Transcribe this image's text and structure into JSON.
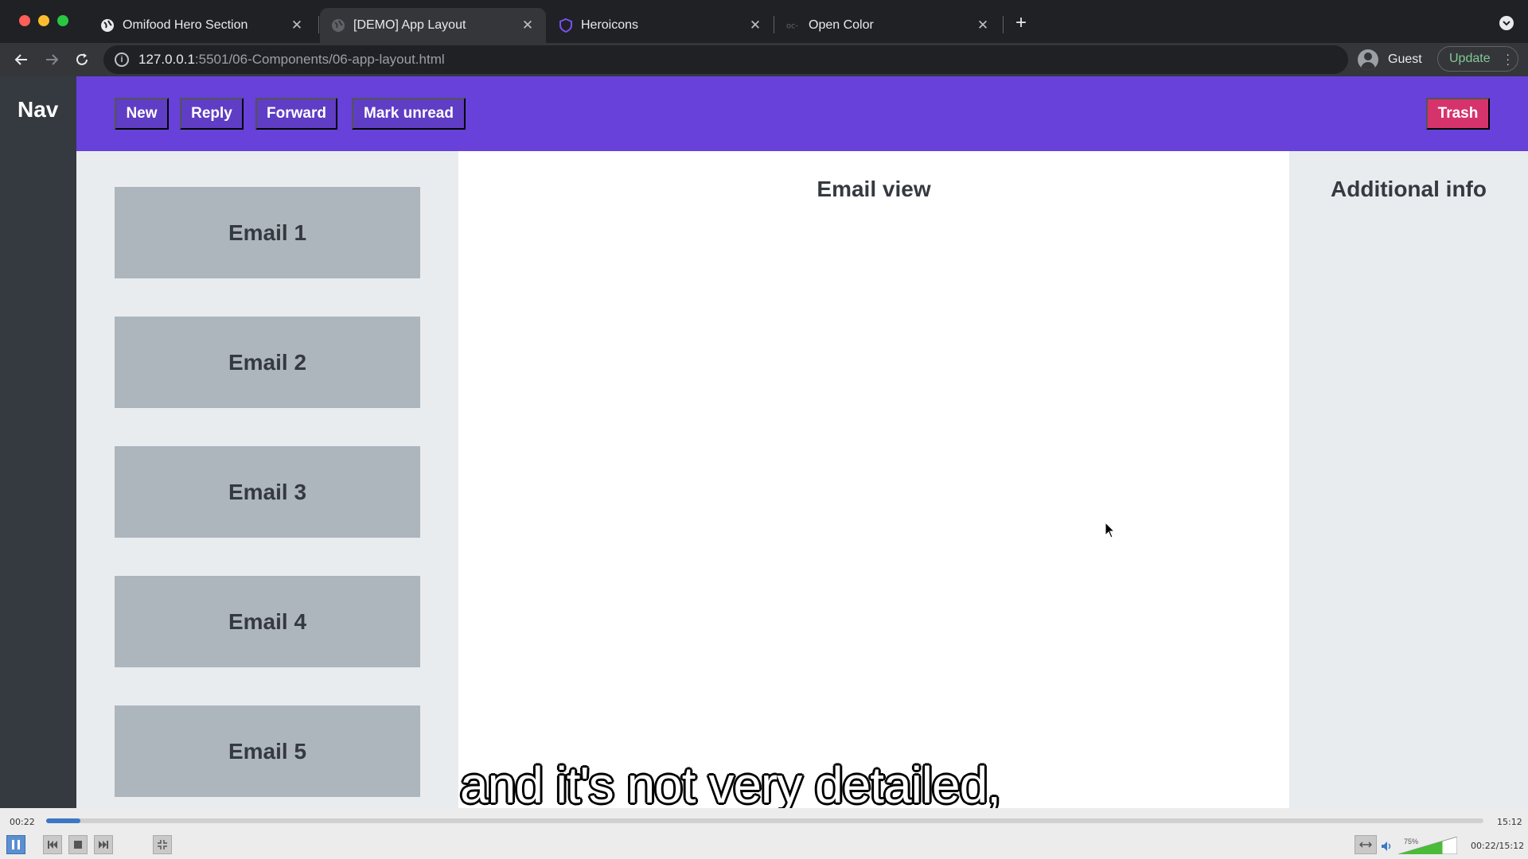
{
  "browser": {
    "tabs": [
      {
        "title": "Omifood Hero Section",
        "active": false
      },
      {
        "title": "[DEMO] App Layout",
        "active": true
      },
      {
        "title": "Heroicons",
        "active": false
      },
      {
        "title": "Open Color",
        "active": false
      }
    ],
    "url_host": "127.0.0.1",
    "url_rest": ":5501/06-Components/06-app-layout.html",
    "profile_label": "Guest",
    "update_label": "Update"
  },
  "page": {
    "nav_title": "Nav",
    "menu_buttons": [
      "New",
      "Reply",
      "Forward",
      "Mark unread"
    ],
    "trash_label": "Trash",
    "emails": [
      "Email 1",
      "Email 2",
      "Email 3",
      "Email 4",
      "Email 5"
    ],
    "email_view_title": "Email view",
    "aside_title": "Additional info",
    "colors": {
      "nav_bg": "#343a40",
      "menu_bg": "#6741d9",
      "button_bg": "#5f3dc4",
      "trash_bg": "#d6336c",
      "email_bg": "#adb5bd",
      "panel_bg": "#e9ecef"
    }
  },
  "subtitle": "and it's not very detailed,",
  "player": {
    "elapsed": "00:22",
    "total": "15:12",
    "progress": 0.024,
    "volume_label": "75%",
    "duration_display": "00:22/15:12"
  }
}
